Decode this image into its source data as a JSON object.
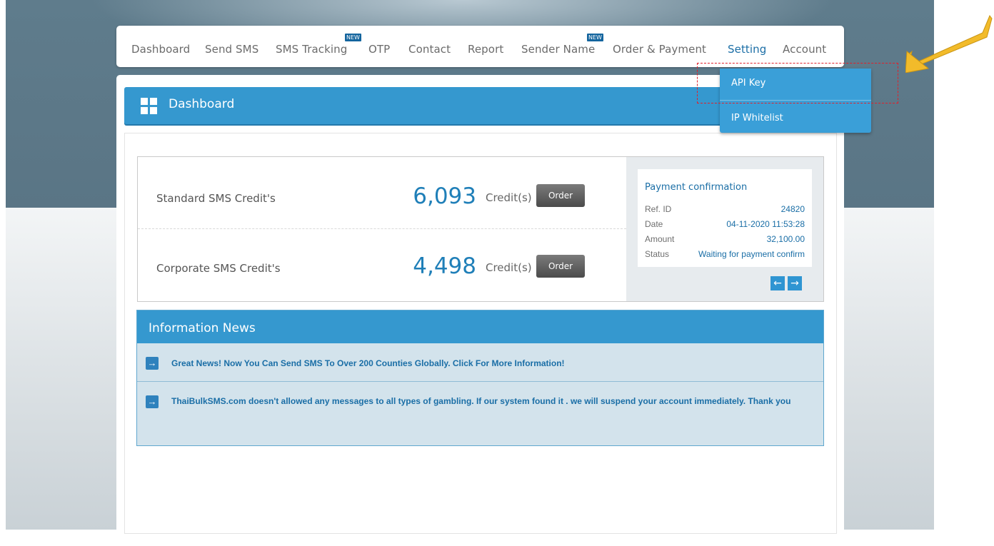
{
  "nav": {
    "items": [
      "Dashboard",
      "Send SMS",
      "SMS Tracking",
      "OTP",
      "Contact",
      "Report",
      "Sender Name",
      "Order & Payment",
      "Setting",
      "Account"
    ],
    "badge": "NEW",
    "active": "Setting"
  },
  "dropdown": {
    "items": [
      "API Key",
      "IP Whitelist"
    ]
  },
  "dashboard": {
    "title": "Dashboard"
  },
  "credits": [
    {
      "label": "Standard SMS Credit's",
      "value": "6,093",
      "unit": "Credit(s)",
      "button": "Order"
    },
    {
      "label": "Corporate SMS Credit's",
      "value": "4,498",
      "unit": "Credit(s)",
      "button": "Order"
    }
  ],
  "payment": {
    "title": "Payment confirmation",
    "rows": [
      {
        "key": "Ref. ID",
        "value": "24820"
      },
      {
        "key": "Date",
        "value": "04-11-2020 11:53:28"
      },
      {
        "key": "Amount",
        "value": "32,100.00"
      },
      {
        "key": "Status",
        "value": "Waiting for payment confirm"
      }
    ],
    "prev_glyph": "←",
    "next_glyph": "→"
  },
  "news": {
    "title": "Information News",
    "arrow_glyph": "→",
    "items": [
      "Great News! Now You Can Send SMS To Over 200 Counties Globally. Click For More Information!",
      "ThaiBulkSMS.com doesn't allowed any messages to all types of gambling. If our system found it . we will suspend your account immediately. Thank you"
    ]
  },
  "colors": {
    "primary": "#3598cf",
    "link": "#1a6ea6",
    "highlight": "#e0202a",
    "callout": "#f2bb2a"
  },
  "icons": [
    "dashboard-grid-icon",
    "arrow-left-icon",
    "arrow-right-icon",
    "news-arrow-icon",
    "callout-arrow-icon"
  ]
}
